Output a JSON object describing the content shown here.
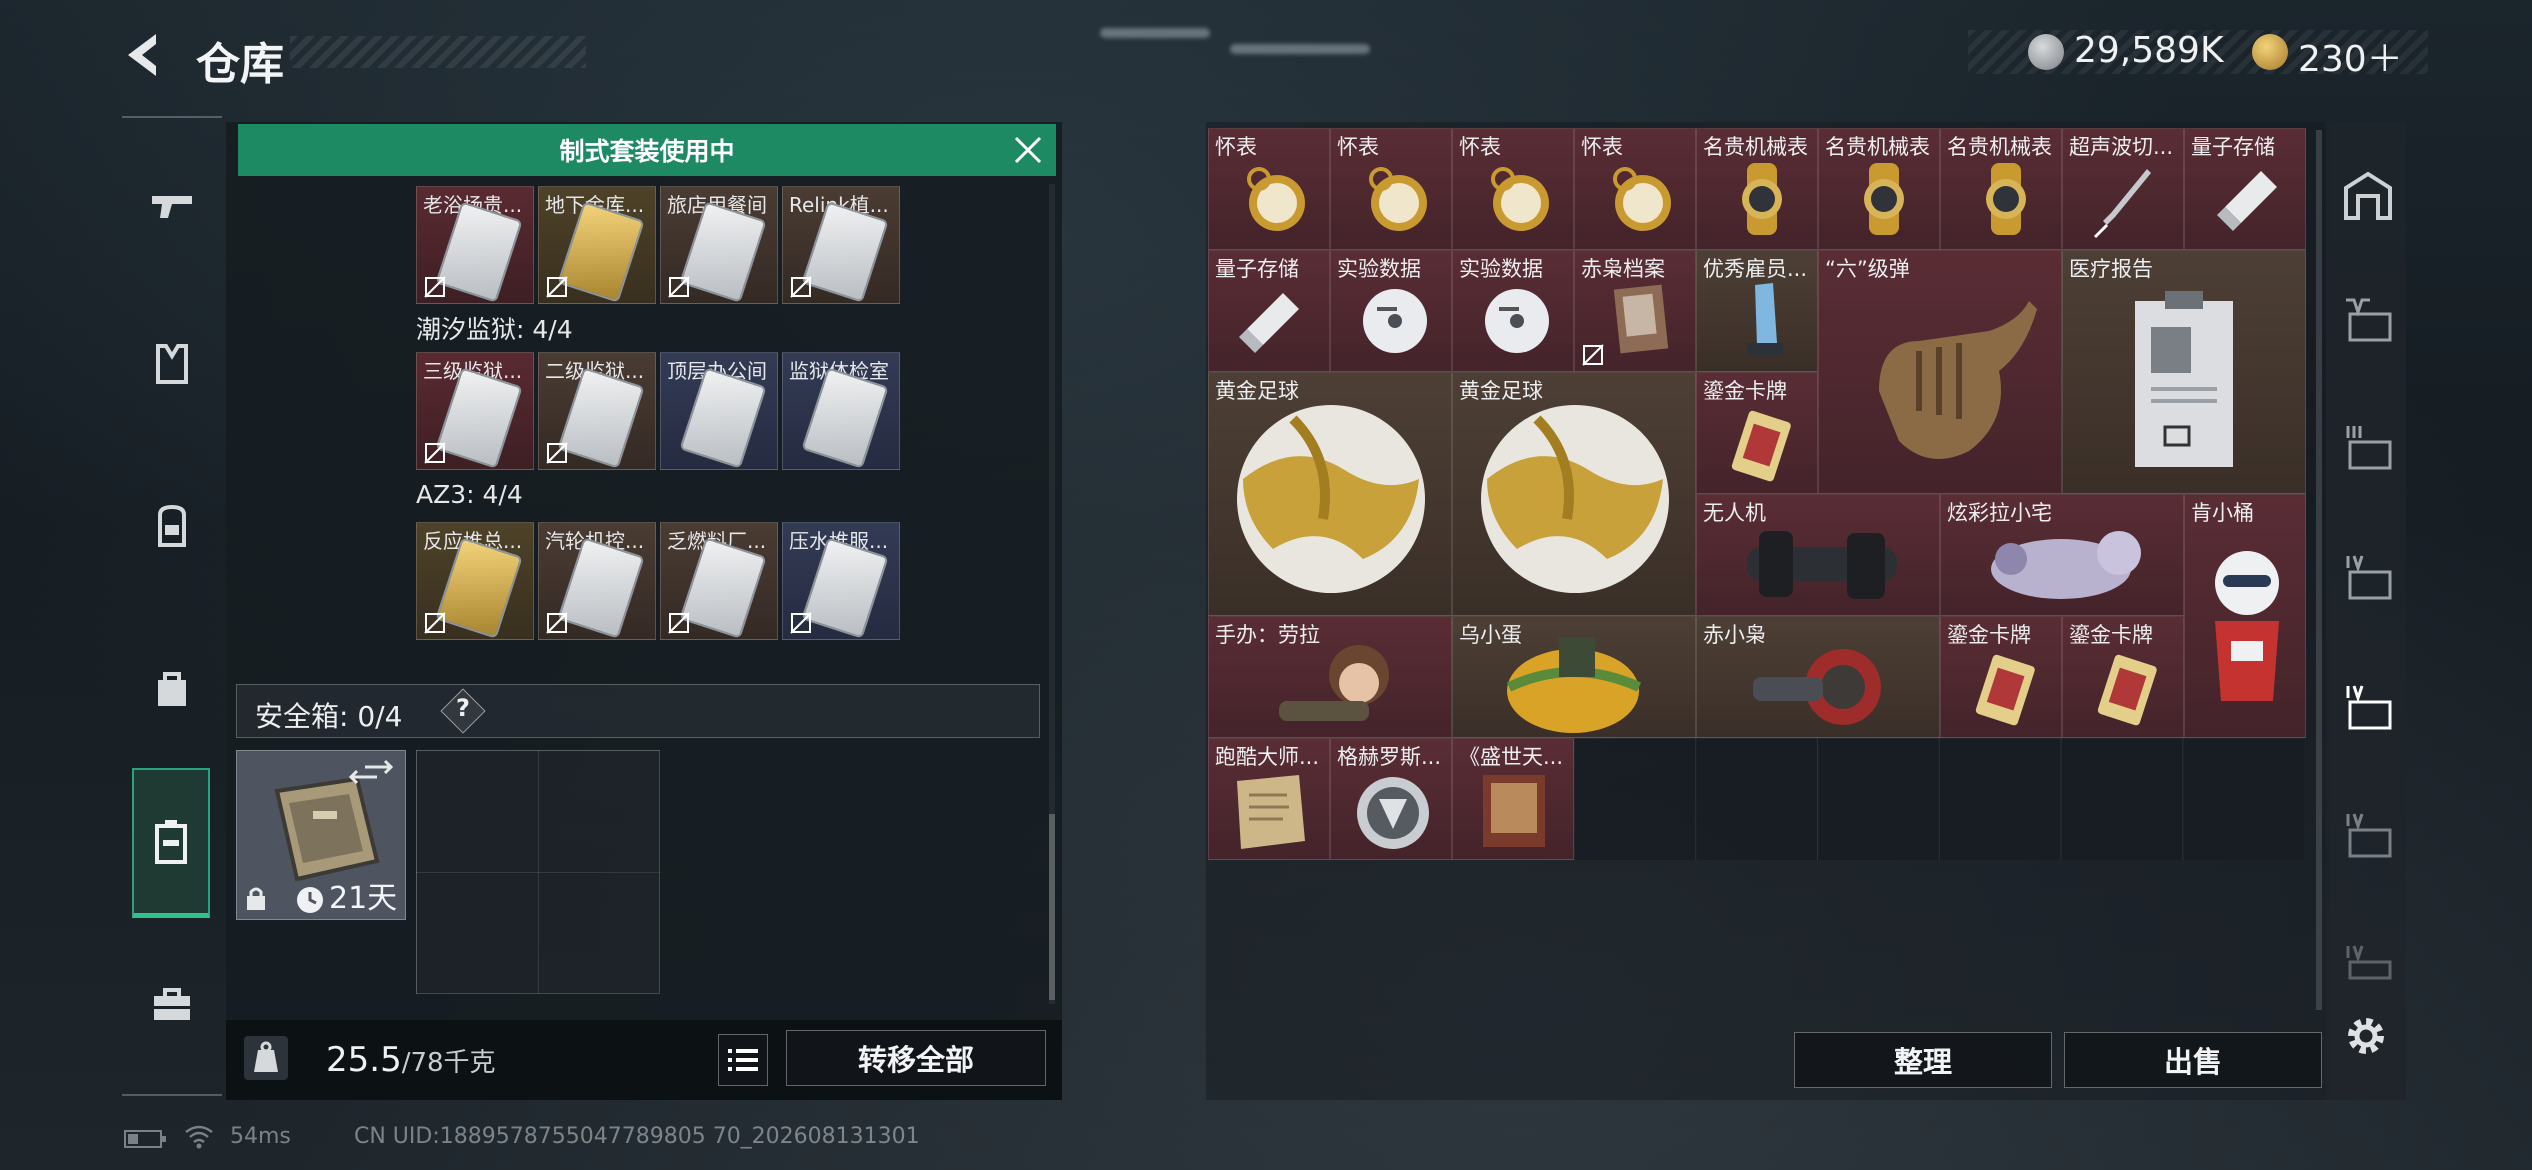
{
  "header": {
    "title": "仓库",
    "currency1": "29,589K",
    "currency2": "230＋"
  },
  "colors": {
    "accent": "#2fc18e",
    "banner": "#1e8a64",
    "red_rarity": "#5a2d35",
    "gold_rarity": "#4e4228"
  },
  "left_nav": {
    "items": [
      "gun-icon",
      "armor-vest-icon",
      "backpack-icon",
      "bag-icon",
      "safe-case-icon",
      "toolbox-icon"
    ],
    "active": "safe-case-icon"
  },
  "kit_panel": {
    "banner": "制式套装使用中",
    "rows": [
      {
        "label": "",
        "cards": [
          "老浴场贵...",
          "地下金库...",
          "旅店用餐间",
          "Relink植..."
        ]
      },
      {
        "label": "潮汐监狱: 4/4",
        "cards": [
          "三级监狱...",
          "二级监狱...",
          "顶层办公间",
          "监狱体检室"
        ]
      },
      {
        "label": "AZ3: 4/4",
        "cards": [
          "反应堆总...",
          "汽轮机控...",
          "乏燃料厂...",
          "压水堆服..."
        ]
      }
    ],
    "safe_box_label": "安全箱:",
    "safe_box_count": "0/4",
    "help": "?",
    "safe_days": "21天",
    "weight_current": "25.5",
    "weight_max": "/78千克",
    "transfer_all": "转移全部"
  },
  "storage": {
    "items": [
      {
        "name": "怀表"
      },
      {
        "name": "怀表"
      },
      {
        "name": "怀表"
      },
      {
        "name": "怀表"
      },
      {
        "name": "名贵机械表"
      },
      {
        "name": "名贵机械表"
      },
      {
        "name": "名贵机械表"
      },
      {
        "name": "超声波切..."
      },
      {
        "name": "量子存储"
      },
      {
        "name": "量子存储"
      },
      {
        "name": "实验数据"
      },
      {
        "name": "实验数据"
      },
      {
        "name": "赤枭档案"
      },
      {
        "name": "优秀雇员..."
      },
      {
        "name": "“六”级弹"
      },
      {
        "name": "医疗报告"
      },
      {
        "name": "黄金足球"
      },
      {
        "name": "黄金足球"
      },
      {
        "name": "鎏金卡牌"
      },
      {
        "name": "无人机"
      },
      {
        "name": "炫彩拉小宅"
      },
      {
        "name": "肯小桶"
      },
      {
        "name": "手办：劳拉"
      },
      {
        "name": "乌小蛋"
      },
      {
        "name": "赤小枭"
      },
      {
        "name": "鎏金卡牌"
      },
      {
        "name": "鎏金卡牌"
      },
      {
        "name": "跑酷大师..."
      },
      {
        "name": "格赫罗斯..."
      },
      {
        "name": "《盛世天..."
      }
    ],
    "sort_button": "整理",
    "sell_button": "出售"
  },
  "right_nav": [
    "home-room-icon",
    "tier-v-case-icon",
    "tier-iii-case-icon",
    "tier-iv-case-icon",
    "tier-iv-case-icon",
    "tier-iv-case-icon",
    "tier-iv-case-icon",
    "settings-gear-icon"
  ],
  "status_bar": {
    "ping": "54ms",
    "uid": "CN UID:1889578755047789805 70_202608131301"
  }
}
